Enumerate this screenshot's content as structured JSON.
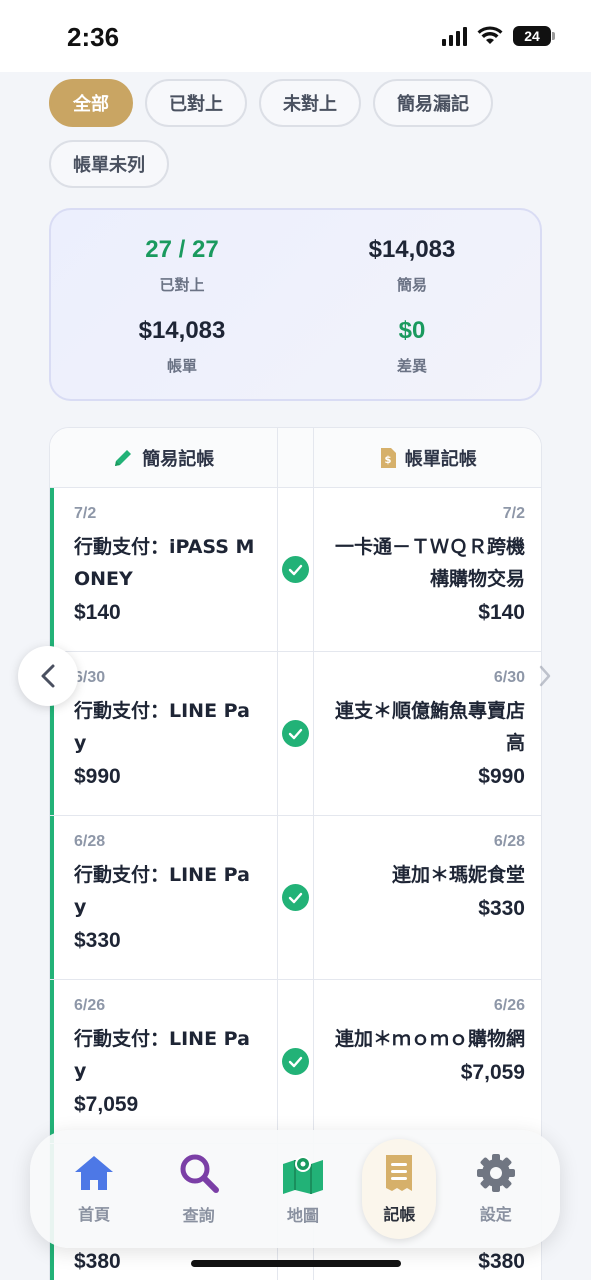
{
  "status": {
    "time": "2:36",
    "battery": "24"
  },
  "filters": [
    {
      "label": "全部",
      "active": true
    },
    {
      "label": "已對上",
      "active": false
    },
    {
      "label": "未對上",
      "active": false
    },
    {
      "label": "簡易漏記",
      "active": false
    },
    {
      "label": "帳單未列",
      "active": false
    }
  ],
  "summary": {
    "matched_value": "27 / 27",
    "matched_label": "已對上",
    "simple_value": "$14,083",
    "simple_label": "簡易",
    "bill_value": "$14,083",
    "bill_label": "帳單",
    "diff_value": "$0",
    "diff_label": "差異"
  },
  "list": {
    "left_header": "簡易記帳",
    "right_header": "帳單記帳",
    "rows": [
      {
        "left_date": "7/2",
        "left_desc": "行動支付：iPASS MONEY",
        "left_amount": "$140",
        "right_date": "7/2",
        "right_desc": "一卡通－ＴＷＱＲ跨機構購物交易",
        "right_amount": "$140"
      },
      {
        "left_date": "6/30",
        "left_desc": "行動支付：LINE Pay",
        "left_amount": "$990",
        "right_date": "6/30",
        "right_desc": "連支＊順億鮪魚專賣店高",
        "right_amount": "$990"
      },
      {
        "left_date": "6/28",
        "left_desc": "行動支付：LINE Pay",
        "left_amount": "$330",
        "right_date": "6/28",
        "right_desc": "連加＊瑪妮食堂",
        "right_amount": "$330"
      },
      {
        "left_date": "6/26",
        "left_desc": "行動支付：LINE Pay",
        "left_amount": "$7,059",
        "right_date": "6/26",
        "right_desc": "連加＊ｍｏｍｏ購物網",
        "right_amount": "$7,059"
      },
      {
        "left_date": "",
        "left_desc": "",
        "left_amount": "$380",
        "right_date": "",
        "right_desc": "",
        "right_amount": "$380"
      }
    ]
  },
  "tabbar": [
    {
      "label": "首頁",
      "icon": "home-icon"
    },
    {
      "label": "查詢",
      "icon": "search-icon"
    },
    {
      "label": "地圖",
      "icon": "map-icon"
    },
    {
      "label": "記帳",
      "icon": "receipt-icon",
      "active": true
    },
    {
      "label": "設定",
      "icon": "gear-icon"
    }
  ],
  "colors": {
    "accent": "#c9a563",
    "green": "#22b277",
    "blue": "#4d78e6",
    "purple": "#7b3fa6"
  }
}
